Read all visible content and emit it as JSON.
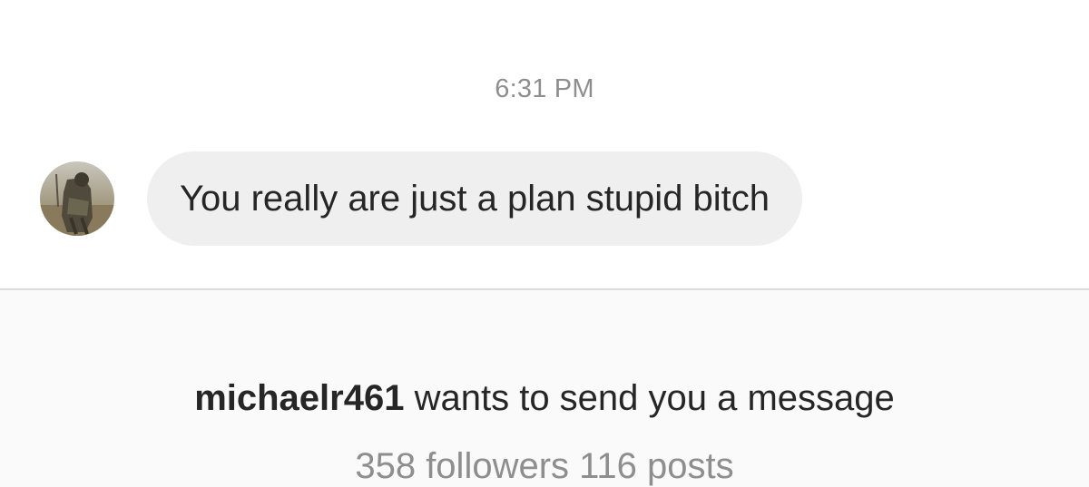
{
  "thread": {
    "timestamp": "6:31 PM",
    "messages": [
      {
        "sender_avatar": "profile-photo",
        "text": "You really are just a plan stupid bitch"
      }
    ]
  },
  "message_request": {
    "username": "michaelr461",
    "request_text": "wants to send you a message",
    "followers": "358 followers",
    "posts": "116 posts"
  },
  "colors": {
    "bubble": "#efefef",
    "text": "#262626",
    "secondary_text": "#8e8e8e",
    "divider": "#dbdbdb",
    "panel_background": "#fafafa"
  }
}
